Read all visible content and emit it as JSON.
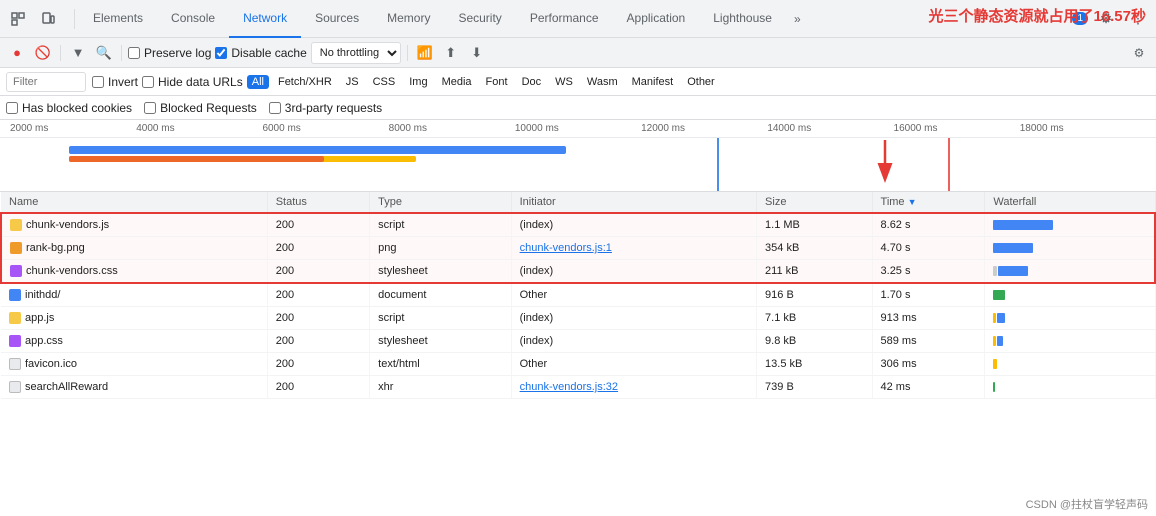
{
  "tabs": {
    "items": [
      {
        "label": "Elements",
        "active": false
      },
      {
        "label": "Console",
        "active": false
      },
      {
        "label": "Network",
        "active": true
      },
      {
        "label": "Sources",
        "active": false
      },
      {
        "label": "Memory",
        "active": false
      },
      {
        "label": "Security",
        "active": false
      },
      {
        "label": "Performance",
        "active": false
      },
      {
        "label": "Application",
        "active": false
      },
      {
        "label": "Lighthouse",
        "active": false
      }
    ],
    "more_label": "»",
    "badge": "1"
  },
  "toolbar": {
    "preserve_log": "Preserve log",
    "disable_cache": "Disable cache",
    "no_throttling": "No throttling",
    "preserve_checked": false,
    "disable_checked": true
  },
  "filter": {
    "placeholder": "Filter",
    "invert": "Invert",
    "hide_data_urls": "Hide data URLs",
    "tags": [
      "All",
      "Fetch/XHR",
      "JS",
      "CSS",
      "Img",
      "Media",
      "Font",
      "Doc",
      "WS",
      "Wasm",
      "Manifest",
      "Other"
    ],
    "active_tag": "All"
  },
  "options": {
    "has_blocked": "Has blocked cookies",
    "blocked_requests": "Blocked Requests",
    "third_party": "3rd-party requests"
  },
  "timeline": {
    "ticks": [
      "2000 ms",
      "4000 ms",
      "6000 ms",
      "8000 ms",
      "10000 ms",
      "12000 ms",
      "14000 ms",
      "16000 ms",
      "18000 ms"
    ]
  },
  "annotation": {
    "text": "光三个静态资源就占用了16.57秒"
  },
  "table": {
    "headers": [
      "Name",
      "Status",
      "Type",
      "Initiator",
      "Size",
      "Time",
      "Waterfall"
    ],
    "rows": [
      {
        "name": "chunk-vendors.js",
        "icon": "js",
        "status": "200",
        "type": "script",
        "initiator": "(index)",
        "initiator_link": false,
        "size": "1.1 MB",
        "time": "8.62 s",
        "highlighted": true,
        "wf_color": "blue",
        "wf_width": 60
      },
      {
        "name": "rank-bg.png",
        "icon": "png",
        "status": "200",
        "type": "png",
        "initiator": "chunk-vendors.js:1",
        "initiator_link": true,
        "size": "354 kB",
        "time": "4.70 s",
        "highlighted": true,
        "wf_color": "blue",
        "wf_width": 40
      },
      {
        "name": "chunk-vendors.css",
        "icon": "css",
        "status": "200",
        "type": "stylesheet",
        "initiator": "(index)",
        "initiator_link": false,
        "size": "211 kB",
        "time": "3.25 s",
        "highlighted": true,
        "wf_color": "mixed",
        "wf_width": 30
      },
      {
        "name": "inithdd/",
        "icon": "doc",
        "status": "200",
        "type": "document",
        "initiator": "Other",
        "initiator_link": false,
        "size": "916 B",
        "time": "1.70 s",
        "highlighted": false,
        "wf_color": "green",
        "wf_width": 12
      },
      {
        "name": "app.js",
        "icon": "app-js",
        "status": "200",
        "type": "script",
        "initiator": "(index)",
        "initiator_link": false,
        "size": "7.1 kB",
        "time": "913 ms",
        "highlighted": false,
        "wf_color": "mixed2",
        "wf_width": 8
      },
      {
        "name": "app.css",
        "icon": "app-css",
        "status": "200",
        "type": "stylesheet",
        "initiator": "(index)",
        "initiator_link": false,
        "size": "9.8 kB",
        "time": "589 ms",
        "highlighted": false,
        "wf_color": "mixed2",
        "wf_width": 6
      },
      {
        "name": "favicon.ico",
        "icon": "ico",
        "status": "200",
        "type": "text/html",
        "initiator": "Other",
        "initiator_link": false,
        "size": "13.5 kB",
        "time": "306 ms",
        "highlighted": false,
        "wf_color": "orange",
        "wf_width": 4
      },
      {
        "name": "searchAllReward",
        "icon": "xhr",
        "status": "200",
        "type": "xhr",
        "initiator": "chunk-vendors.js:32",
        "initiator_link": true,
        "size": "739 B",
        "time": "42 ms",
        "highlighted": false,
        "wf_color": "green2",
        "wf_width": 2
      }
    ]
  },
  "csdn": "CSDN @拄杖盲学轻声码"
}
